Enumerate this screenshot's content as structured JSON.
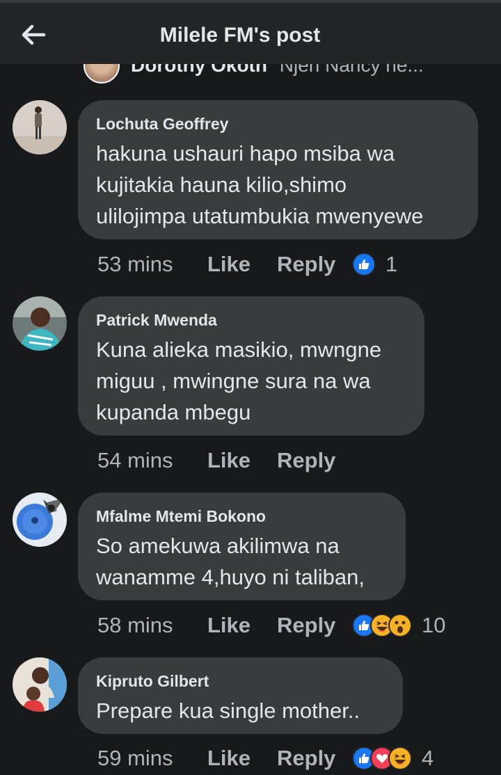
{
  "header": {
    "title": "Milele FM's post",
    "back_icon": "back-arrow-icon"
  },
  "previous_reply": {
    "author": "Dorothy Okoth",
    "text": "Njeri Nancy ne..."
  },
  "comments": [
    {
      "author": "Lochuta Geoffrey",
      "text": "hakuna ushauri hapo  msiba wa\nkujitakia hauna kilio,shimo\nulilojimpa utatumbukia mwenyewe",
      "time": "53 mins",
      "like_label": "Like",
      "reply_label": "Reply",
      "reactions": [
        "like"
      ],
      "reaction_count": "1"
    },
    {
      "author": "Patrick Mwenda",
      "text": "Kuna alieka masikio, mwngne\nmiguu , mwingne sura na wa\nkupanda mbegu",
      "time": "54 mins",
      "like_label": "Like",
      "reply_label": "Reply",
      "reactions": [],
      "reaction_count": ""
    },
    {
      "author": "Mfalme Mtemi Bokono",
      "text": "So amekuwa akilimwa na\nwanamme 4,huyo ni taliban,",
      "time": "58 mins",
      "like_label": "Like",
      "reply_label": "Reply",
      "reactions": [
        "like",
        "haha",
        "wow"
      ],
      "reaction_count": "10"
    },
    {
      "author": "Kipruto Gilbert",
      "text": "Prepare kua single mother..",
      "time": "59 mins",
      "like_label": "Like",
      "reply_label": "Reply",
      "reactions": [
        "like",
        "love",
        "haha"
      ],
      "reaction_count": "4"
    }
  ],
  "colors": {
    "background": "#18191a",
    "header": "#242526",
    "bubble": "#3a3b3c",
    "primary_text": "#e4e6eb",
    "secondary_text": "#b0b3b8",
    "like_blue": "#1877f2",
    "love_red": "#f33e58",
    "haha_yellow": "#f7b125"
  }
}
